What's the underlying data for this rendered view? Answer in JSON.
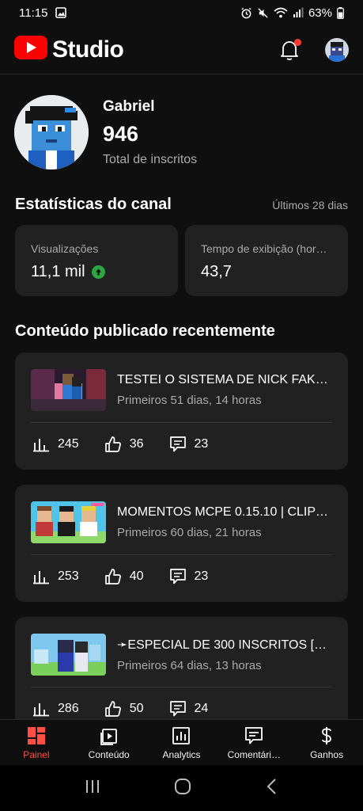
{
  "status_bar": {
    "time": "11:15",
    "battery": "63%"
  },
  "header": {
    "brand_name": "Studio"
  },
  "profile": {
    "name": "Gabriel",
    "subscribers": "946",
    "subscribers_label": "Total de inscritos"
  },
  "channel_stats": {
    "title": "Estatísticas do canal",
    "period": "Últimos 28 dias",
    "cards": [
      {
        "label": "Visualizações",
        "value": "11,1 mil",
        "trend": "up"
      },
      {
        "label": "Tempo de exibição (hor…",
        "value": "43,7"
      }
    ]
  },
  "recent": {
    "title": "Conteúdo publicado recentemente",
    "videos": [
      {
        "title": "TESTEI O SISTEMA DE NICK FAKE…",
        "age": "Primeiros 51 dias, 14 horas",
        "views": "245",
        "likes": "36",
        "comments": "23"
      },
      {
        "title": "MOMENTOS MCPE 0.15.10 | CLIP…",
        "age": "Primeiros 60 dias, 21 horas",
        "views": "253",
        "likes": "40",
        "comments": "23"
      },
      {
        "title": "➛ESPECIAL DE 300 INSCRITOS […",
        "age": "Primeiros 64 dias, 13 horas",
        "views": "286",
        "likes": "50",
        "comments": "24"
      }
    ]
  },
  "bottom_nav": {
    "items": [
      {
        "label": "Painel",
        "icon": "dashboard-icon",
        "active": true
      },
      {
        "label": "Conteúdo",
        "icon": "content-icon"
      },
      {
        "label": "Analytics",
        "icon": "analytics-icon"
      },
      {
        "label": "Comentári…",
        "icon": "comments-icon"
      },
      {
        "label": "Ganhos",
        "icon": "earn-icon"
      }
    ]
  },
  "colors": {
    "accent": "#ff4e45",
    "brand_red": "#ff0000",
    "card_bg": "#212121",
    "trend_up": "#2ba640"
  }
}
